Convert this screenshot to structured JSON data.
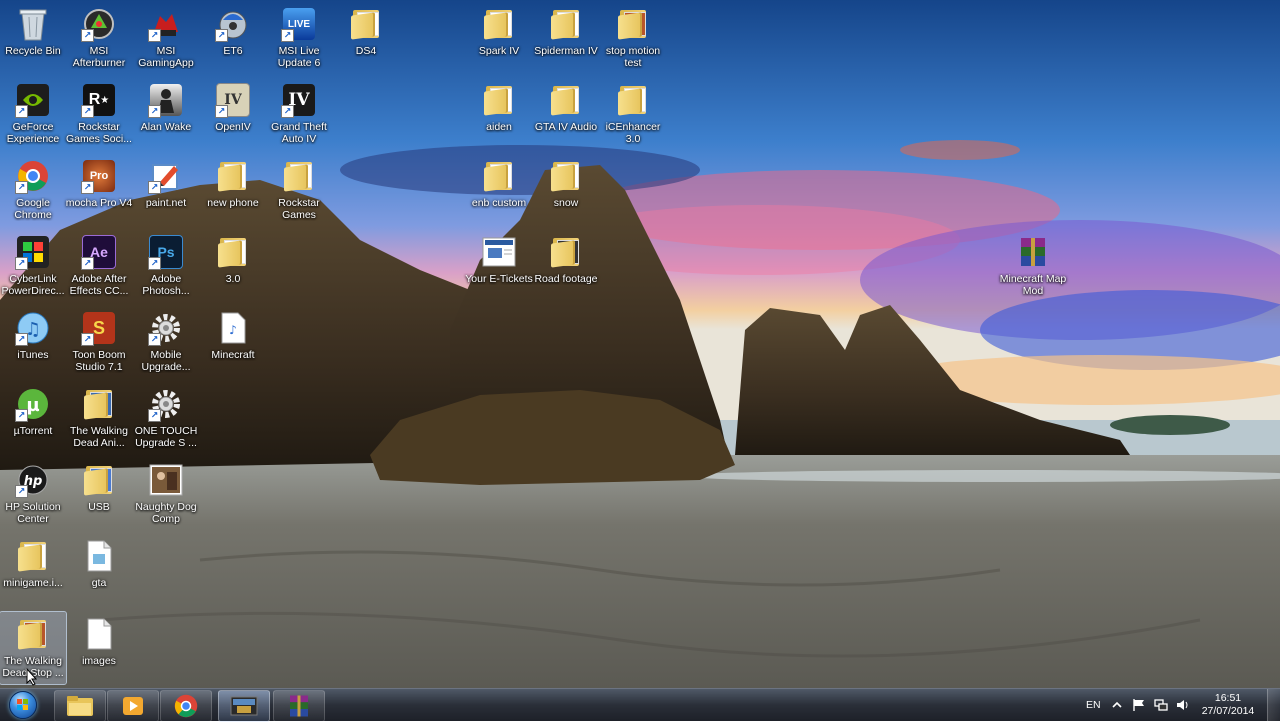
{
  "desktop": {
    "icons": [
      {
        "label": "Recycle Bin",
        "icon": "recycle-bin-icon"
      },
      {
        "label": "MSI Afterburner",
        "icon": "msi-afterburner-icon"
      },
      {
        "label": "MSI GamingApp",
        "icon": "msi-gamingapp-icon"
      },
      {
        "label": "ET6",
        "icon": "et6-icon"
      },
      {
        "label": "MSI Live Update 6",
        "icon": "msi-live-update-icon"
      },
      {
        "label": "DS4",
        "icon": "folder-icon"
      },
      {
        "label": "Spark IV",
        "icon": "folder-icon"
      },
      {
        "label": "Spiderman IV",
        "icon": "folder-icon"
      },
      {
        "label": "stop motion test",
        "icon": "folder-icon"
      },
      {
        "label": "GeForce Experience",
        "icon": "geforce-icon"
      },
      {
        "label": "Rockstar Games Soci...",
        "icon": "rockstar-icon"
      },
      {
        "label": "Alan Wake",
        "icon": "alan-wake-icon"
      },
      {
        "label": "OpenIV",
        "icon": "openiv-icon"
      },
      {
        "label": "Grand Theft Auto IV",
        "icon": "gta-iv-icon"
      },
      {
        "label": "aiden",
        "icon": "folder-icon"
      },
      {
        "label": "GTA IV Audio",
        "icon": "folder-icon"
      },
      {
        "label": "iCEnhancer 3.0",
        "icon": "folder-icon"
      },
      {
        "label": "Google Chrome",
        "icon": "chrome-icon"
      },
      {
        "label": "mocha Pro V4",
        "icon": "mocha-pro-icon"
      },
      {
        "label": "paint.net",
        "icon": "paint-net-icon"
      },
      {
        "label": "new phone",
        "icon": "folder-icon"
      },
      {
        "label": "Rockstar Games",
        "icon": "folder-icon"
      },
      {
        "label": "enb custom",
        "icon": "folder-icon"
      },
      {
        "label": "snow",
        "icon": "folder-icon"
      },
      {
        "label": "CyberLink PowerDirec...",
        "icon": "cyberlink-icon"
      },
      {
        "label": "Adobe After Effects CC...",
        "icon": "after-effects-icon"
      },
      {
        "label": "Adobe Photosh...",
        "icon": "photoshop-icon"
      },
      {
        "label": "3.0",
        "icon": "folder-icon"
      },
      {
        "label": "Your E-Tickets",
        "icon": "document-icon"
      },
      {
        "label": "Road footage",
        "icon": "folder-icon"
      },
      {
        "label": "Minecraft Map Mod",
        "icon": "winrar-icon"
      },
      {
        "label": "iTunes",
        "icon": "itunes-icon"
      },
      {
        "label": "Toon Boom Studio 7.1",
        "icon": "toon-boom-icon"
      },
      {
        "label": "Mobile Upgrade...",
        "icon": "gear-icon"
      },
      {
        "label": "Minecraft",
        "icon": "mp3-icon"
      },
      {
        "label": "µTorrent",
        "icon": "utorrent-icon"
      },
      {
        "label": "The Walking Dead Ani...",
        "icon": "folder-icon"
      },
      {
        "label": "ONE TOUCH Upgrade S ...",
        "icon": "gear-icon"
      },
      {
        "label": "HP Solution Center",
        "icon": "hp-icon"
      },
      {
        "label": "USB",
        "icon": "folder-icon"
      },
      {
        "label": "Naughty Dog Comp",
        "icon": "image-icon"
      },
      {
        "label": "minigame.i...",
        "icon": "folder-icon"
      },
      {
        "label": "gta",
        "icon": "file-icon"
      },
      {
        "label": "The Walking Dead Stop ...",
        "icon": "folder-icon"
      },
      {
        "label": "images",
        "icon": "file-icon"
      }
    ]
  },
  "taskbar": {
    "pinned": [
      {
        "name": "windows-explorer",
        "icon": "folder-icon"
      },
      {
        "name": "media-player",
        "icon": "media-player-icon"
      },
      {
        "name": "google-chrome",
        "icon": "chrome-icon"
      },
      {
        "name": "video-app",
        "icon": "video-icon"
      },
      {
        "name": "winrar",
        "icon": "winrar-icon"
      }
    ],
    "language": "EN",
    "time": "16:51",
    "date": "27/07/2014"
  }
}
